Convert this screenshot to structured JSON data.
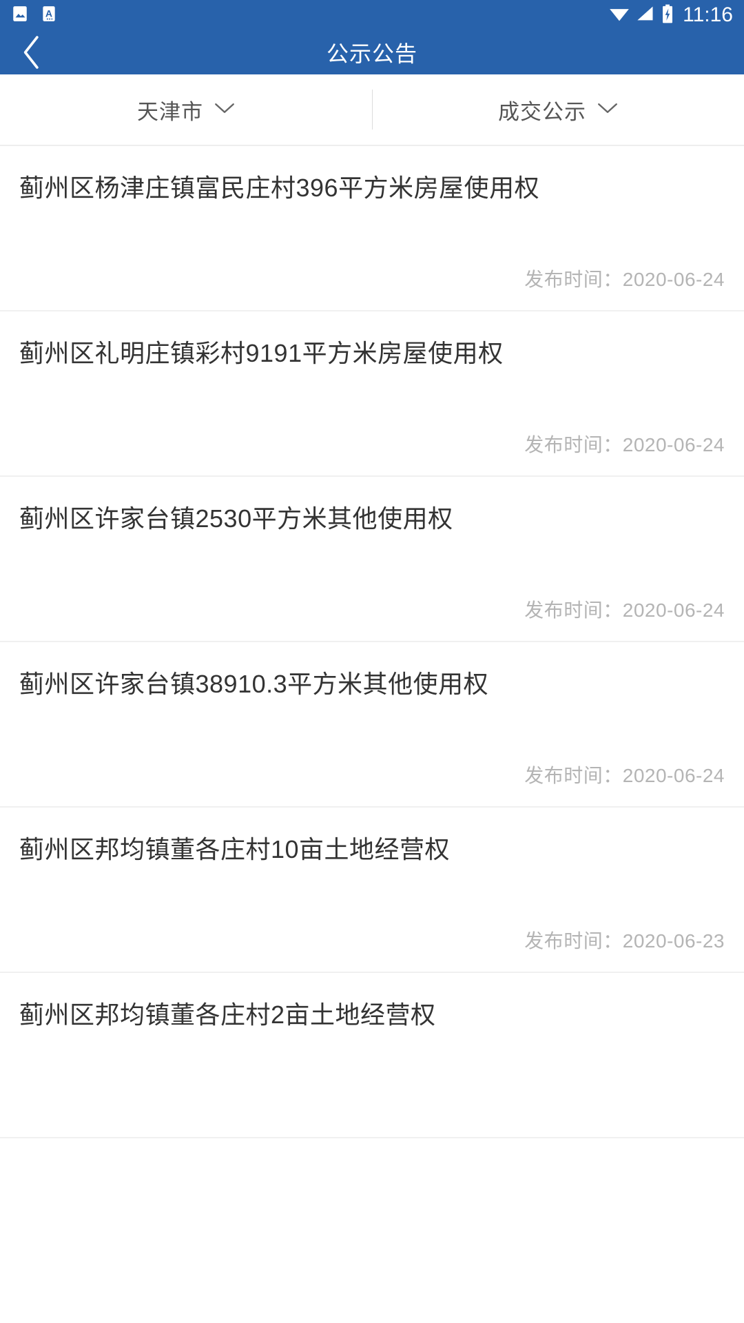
{
  "status_bar": {
    "background": "#2862ab",
    "left_icons": [
      {
        "name": "image-icon",
        "label": "图片"
      },
      {
        "name": "text-capture-icon",
        "label": "A"
      }
    ],
    "right_icons": [
      {
        "name": "wifi-icon",
        "label": "WiFi"
      },
      {
        "name": "cellular-signal-icon",
        "label": "信号"
      },
      {
        "name": "battery-charging-icon",
        "label": "充电中"
      }
    ],
    "time": "11:16"
  },
  "app_bar": {
    "background": "#2862ab",
    "title": "公示公告",
    "back_label": "返回"
  },
  "filters": [
    {
      "label": "天津市",
      "icon": "chevron-down-icon"
    },
    {
      "label": "成交公示",
      "icon": "chevron-down-icon"
    }
  ],
  "list": {
    "meta_label": "发布时间：",
    "items": [
      {
        "title": "蓟州区杨津庄镇富民庄村396平方米房屋使用权",
        "date": "2020-06-24"
      },
      {
        "title": "蓟州区礼明庄镇彩村9191平方米房屋使用权",
        "date": "2020-06-24"
      },
      {
        "title": "蓟州区许家台镇2530平方米其他使用权",
        "date": "2020-06-24"
      },
      {
        "title": "蓟州区许家台镇38910.3平方米其他使用权",
        "date": "2020-06-24"
      },
      {
        "title": "蓟州区邦均镇董各庄村10亩土地经营权",
        "date": "2020-06-23"
      },
      {
        "title": "蓟州区邦均镇董各庄村2亩土地经营权",
        "date": ""
      }
    ]
  },
  "colors": {
    "brand_blue": "#2862ab",
    "title_text": "#333333",
    "meta_text": "#b4b4b4",
    "filter_text": "#555555",
    "divider": "#f0f0f0"
  }
}
